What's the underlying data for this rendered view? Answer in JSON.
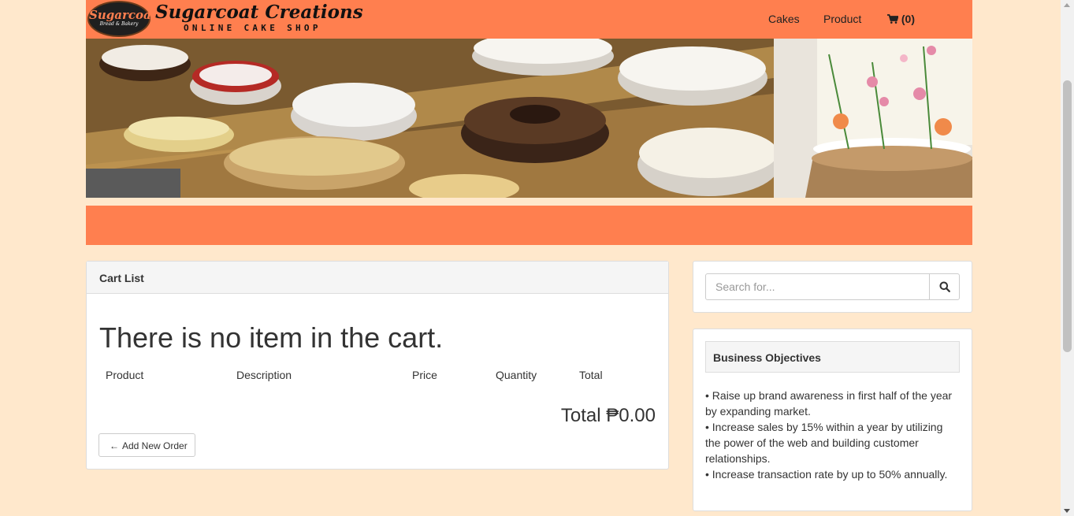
{
  "navbar": {
    "logo_text": "Sugarcoat",
    "logo_subtext": "Bread & Bakery",
    "brand_title": "Sugarcoat Creations",
    "brand_subtitle": "ONLINE CAKE SHOP",
    "links": [
      {
        "label": "Cakes"
      },
      {
        "label": "Product"
      }
    ],
    "cart_count": "(0)"
  },
  "cart": {
    "title": "Cart List",
    "empty_message": "There is no item in the cart.",
    "columns": [
      "Product",
      "Description",
      "Price",
      "Quantity",
      "Total"
    ],
    "total_label": "Total ₱0.00",
    "add_button_label": "Add New Order"
  },
  "search": {
    "placeholder": "Search for..."
  },
  "objectives": {
    "title": "Business Objectives",
    "items": [
      "• Raise up brand awareness in first half of the year by expanding market.",
      "• Increase sales by 15% within a year by utilizing the power of the web and building customer relationships.",
      "• Increase transaction rate by up to 50% annually."
    ]
  },
  "colors": {
    "page_bg": "#ffe8cc",
    "accent": "#ff7f4f"
  }
}
